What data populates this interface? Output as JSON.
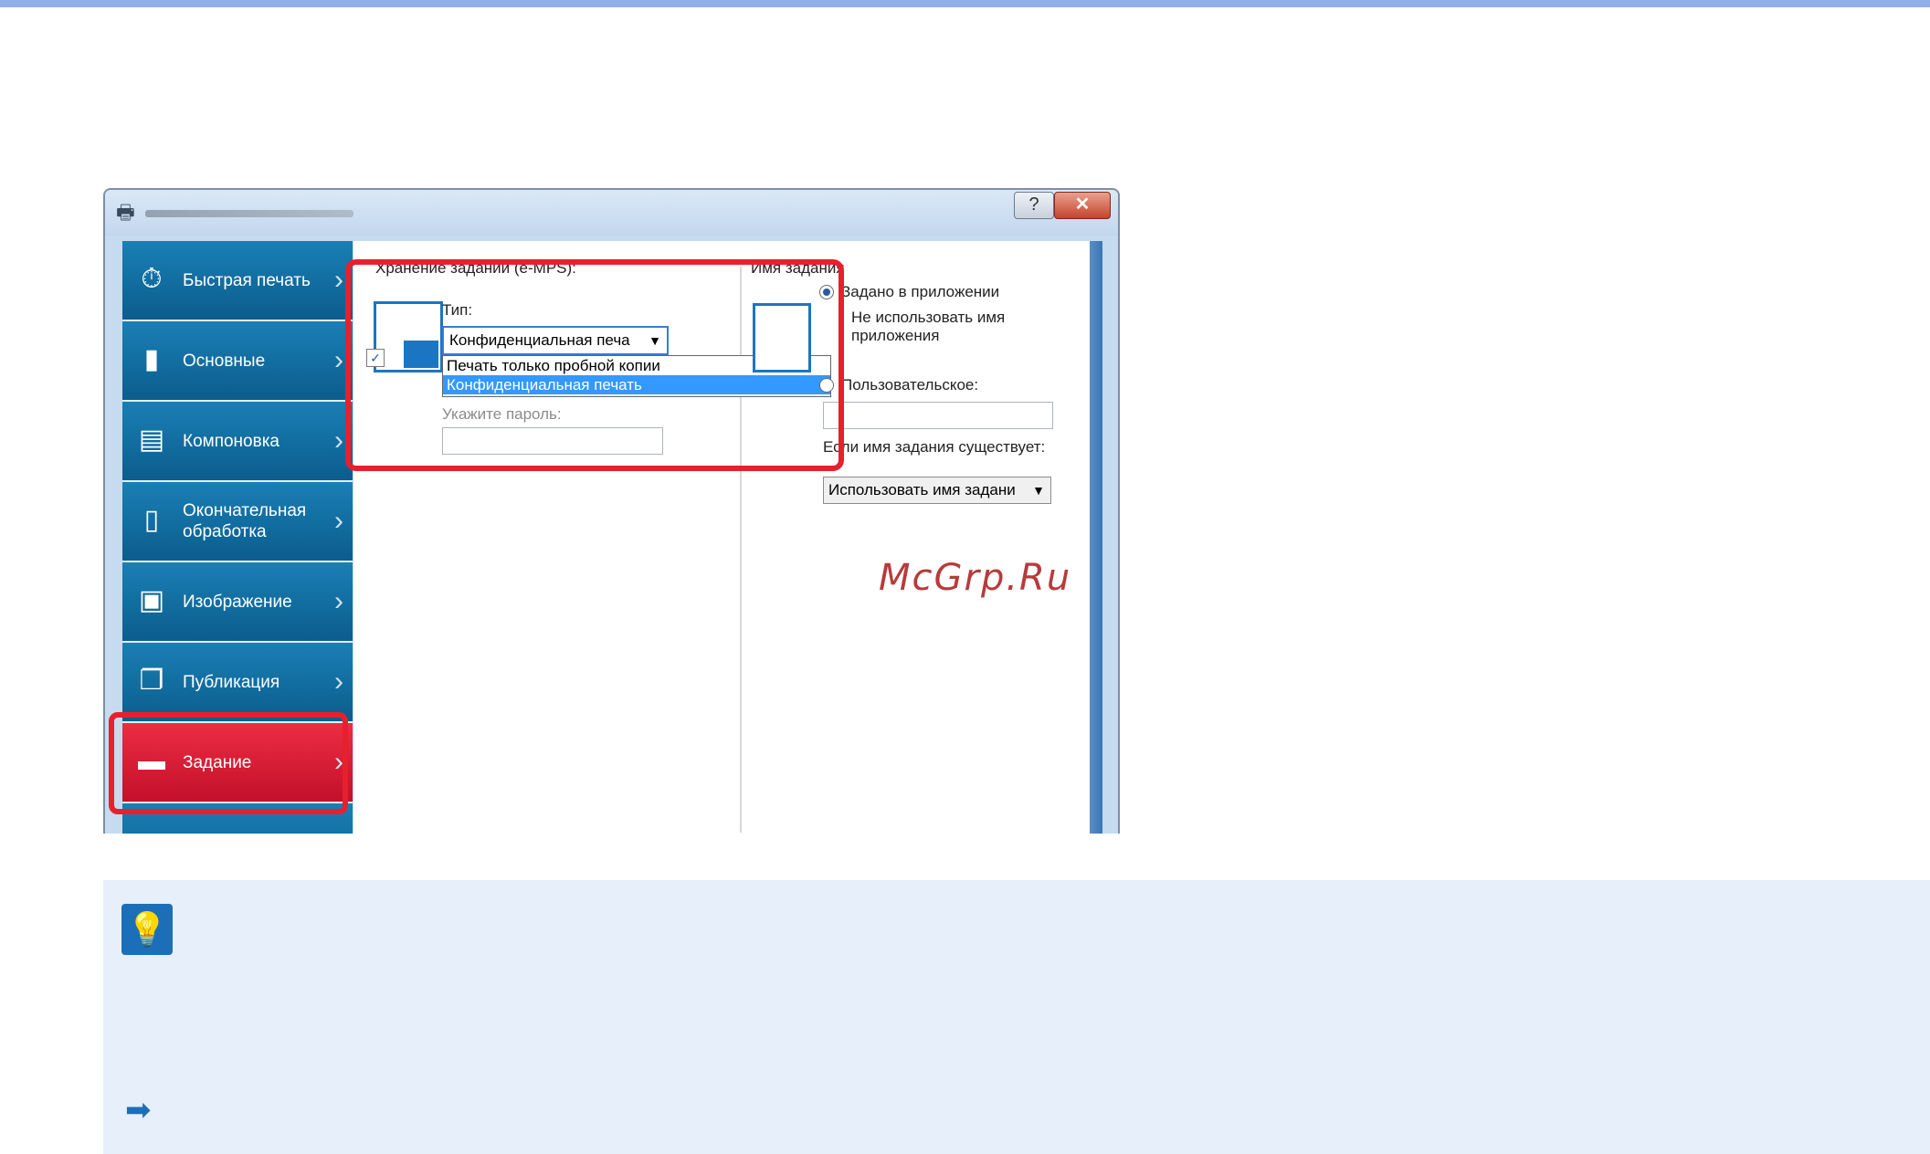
{
  "window": {
    "help_glyph": "?",
    "close_glyph": "✕"
  },
  "sidebar": {
    "items": [
      {
        "label": "Быстрая печать",
        "icon": "stopwatch-icon"
      },
      {
        "label": "Основные",
        "icon": "page-icon"
      },
      {
        "label": "Компоновка",
        "icon": "layout-icon"
      },
      {
        "label": "Окончательная обработка",
        "icon": "finishing-icon"
      },
      {
        "label": "Изображение",
        "icon": "image-icon"
      },
      {
        "label": "Публикация",
        "icon": "publishing-icon"
      },
      {
        "label": "Задание",
        "icon": "job-icon",
        "active": true
      }
    ]
  },
  "job_storage": {
    "section_title": "Хранение заданий (e-MPS):",
    "type_label": "Тип:",
    "type_value": "Конфиденциальная печа",
    "dropdown_options": [
      "Печать только пробной копии",
      "Конфиденциальная печать"
    ],
    "selected_option": "Конфиденциальная печать",
    "password_label": "Укажите пароль:"
  },
  "job_name": {
    "section_title": "Имя задания",
    "radio_app": "Задано в приложении",
    "checkbox_no_app": "Не использовать имя приложения",
    "radio_custom": "Пользовательское:",
    "exists_label": "Если имя задания существует:",
    "exists_value": "Использовать имя задани"
  },
  "watermark": "McGrp.Ru",
  "colors": {
    "accent_red": "#e8202d",
    "nav_blue": "#1a7fb5",
    "nav_active": "#d8172f",
    "note_bg": "#e7effb"
  }
}
